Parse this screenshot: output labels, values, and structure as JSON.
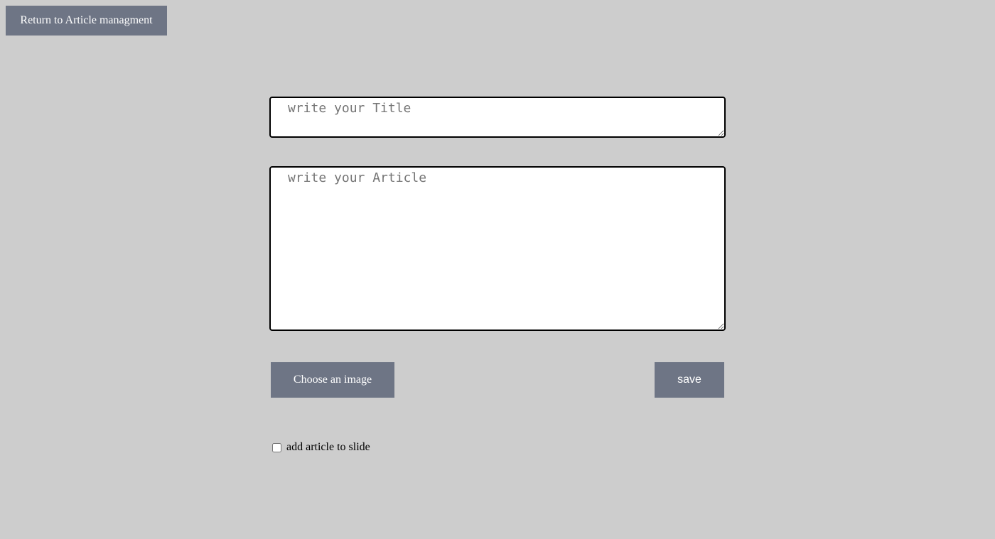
{
  "header": {
    "back_label": "Return to Article managment"
  },
  "form": {
    "title_placeholder": "write your Title",
    "title_value": "",
    "article_placeholder": "write your Article",
    "article_value": "",
    "choose_image_label": "Choose an image",
    "save_label": "save",
    "slide_checkbox_label": "add article to slide",
    "slide_checked": false
  },
  "colors": {
    "background": "#cdcdcd",
    "button": "#6e7585",
    "button_text": "#ffffff"
  }
}
